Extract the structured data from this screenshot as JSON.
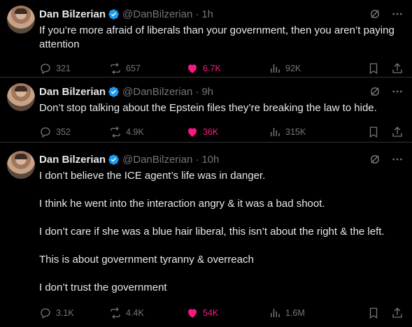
{
  "colors": {
    "background": "#000000",
    "text": "#e7e9ea",
    "muted": "#71767b",
    "like": "#f91880",
    "verified": "#1d9bf0"
  },
  "tweets": [
    {
      "name": "Dan Bilzerian",
      "handle": "@DanBilzerian",
      "time": "1h",
      "paragraphs": [
        "If you’re more afraid of liberals than your government, then you aren’t paying attention"
      ],
      "replies": "321",
      "reposts": "657",
      "likes": "6.7K",
      "views": "92K"
    },
    {
      "name": "Dan Bilzerian",
      "handle": "@DanBilzerian",
      "time": "9h",
      "paragraphs": [
        "Don’t stop talking about the Epstein files they’re breaking the law to hide."
      ],
      "replies": "352",
      "reposts": "4.9K",
      "likes": "36K",
      "views": "315K"
    },
    {
      "name": "Dan Bilzerian",
      "handle": "@DanBilzerian",
      "time": "10h",
      "paragraphs": [
        "I don’t believe the ICE agent’s life was in danger.",
        "I think he went into the interaction angry & it was a bad shoot.",
        "I don’t care if she was a blue hair liberal, this isn’t about the right & the left.",
        "This is about government tyranny & overreach",
        "I don’t trust the government"
      ],
      "replies": "3.1K",
      "reposts": "4.4K",
      "likes": "54K",
      "views": "1.6M"
    }
  ]
}
